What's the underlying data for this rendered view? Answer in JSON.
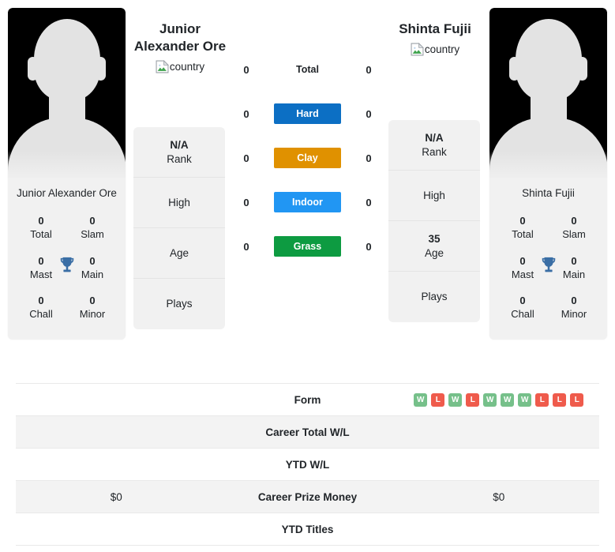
{
  "players": {
    "left": {
      "display_name": "Junior\nAlexander Ore",
      "name_line1": "Junior",
      "name_line2": "Alexander Ore",
      "card_name": "Junior Alexander Ore",
      "country_alt": "country",
      "titles": [
        {
          "value": "0",
          "label": "Total"
        },
        {
          "value": "0",
          "label": "Slam"
        },
        {
          "value": "0",
          "label": "Mast"
        },
        {
          "value": "0",
          "label": "Main"
        },
        {
          "value": "0",
          "label": "Chall"
        },
        {
          "value": "0",
          "label": "Minor"
        }
      ],
      "info": [
        {
          "value": "N/A",
          "label": "Rank"
        },
        {
          "value": "",
          "label": "High"
        },
        {
          "value": "",
          "label": "Age"
        },
        {
          "value": "",
          "label": "Plays"
        }
      ],
      "surface_wins": [
        "0",
        "0",
        "0",
        "0",
        "0"
      ],
      "prize_money": "$0",
      "career_wl": "",
      "ytd_wl": "",
      "ytd_titles": ""
    },
    "right": {
      "display_name": "Shinta Fujii",
      "name_line1": "Shinta Fujii",
      "name_line2": "",
      "card_name": "Shinta Fujii",
      "country_alt": "country",
      "titles": [
        {
          "value": "0",
          "label": "Total"
        },
        {
          "value": "0",
          "label": "Slam"
        },
        {
          "value": "0",
          "label": "Mast"
        },
        {
          "value": "0",
          "label": "Main"
        },
        {
          "value": "0",
          "label": "Chall"
        },
        {
          "value": "0",
          "label": "Minor"
        }
      ],
      "info": [
        {
          "value": "N/A",
          "label": "Rank"
        },
        {
          "value": "",
          "label": "High"
        },
        {
          "value": "35",
          "label": "Age"
        },
        {
          "value": "",
          "label": "Plays"
        }
      ],
      "surface_wins": [
        "0",
        "0",
        "0",
        "0",
        "0"
      ],
      "prize_money": "$0",
      "career_wl": "",
      "ytd_wl": "",
      "ytd_titles": ""
    }
  },
  "surfaces": [
    {
      "label": "Total",
      "color": "transparent",
      "text_color": "#212529",
      "styled": false
    },
    {
      "label": "Hard",
      "color": "#0c6fc4",
      "text_color": "#ffffff",
      "styled": true
    },
    {
      "label": "Clay",
      "color": "#e09100",
      "text_color": "#ffffff",
      "styled": true
    },
    {
      "label": "Indoor",
      "color": "#2196f3",
      "text_color": "#ffffff",
      "styled": true
    },
    {
      "label": "Grass",
      "color": "#0d9b41",
      "text_color": "#ffffff",
      "styled": true
    }
  ],
  "table": {
    "rows": [
      {
        "label": "Form",
        "type": "form"
      },
      {
        "label": "Career Total W/L",
        "type": "text"
      },
      {
        "label": "YTD W/L",
        "type": "text"
      },
      {
        "label": "Career Prize Money",
        "type": "money"
      },
      {
        "label": "YTD Titles",
        "type": "text"
      }
    ],
    "form": {
      "results": [
        "W",
        "L",
        "W",
        "L",
        "W",
        "W",
        "W",
        "L",
        "L",
        "L"
      ],
      "win_color": "#76c08a",
      "loss_color": "#ef5b4c"
    }
  },
  "icons": {
    "trophy": "trophy-icon",
    "broken_image": "broken-image-icon"
  },
  "theme": {
    "card_bg": "#f1f1f1",
    "stripe_bg": "#f3f3f3",
    "trophy_color": "#3a6ea5",
    "avatar_bg": "#000000",
    "silhouette": "#e3e3e3"
  }
}
